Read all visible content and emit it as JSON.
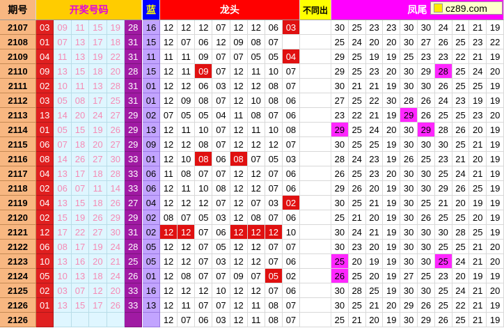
{
  "headers": {
    "period": "期号",
    "winning": "开奖号码",
    "blue": "蓝",
    "longtou": "龙头",
    "buchong": "不同出",
    "fengwei": "凤尾",
    "site": "cz89.com"
  },
  "rows": [
    {
      "period": "2107",
      "win": [
        "03",
        "09",
        "11",
        "15",
        "19",
        "28"
      ],
      "blue": "16",
      "lt": [
        "12",
        "12",
        "12",
        "07",
        "12",
        "12",
        "06",
        "03"
      ],
      "lt_hit": [
        7
      ],
      "fw": [
        "30",
        "25",
        "23",
        "23",
        "30",
        "30",
        "24",
        "21",
        "21",
        "19"
      ],
      "fw_hit": []
    },
    {
      "period": "2108",
      "win": [
        "01",
        "07",
        "13",
        "17",
        "18",
        "31"
      ],
      "blue": "15",
      "lt": [
        "12",
        "07",
        "06",
        "12",
        "09",
        "08",
        "07",
        ""
      ],
      "lt_hit": [],
      "fw": [
        "25",
        "24",
        "20",
        "20",
        "30",
        "27",
        "26",
        "25",
        "23",
        "22"
      ],
      "fw_hit": []
    },
    {
      "period": "2109",
      "win": [
        "04",
        "11",
        "13",
        "19",
        "22",
        "31"
      ],
      "blue": "11",
      "lt": [
        "11",
        "11",
        "09",
        "07",
        "07",
        "05",
        "05",
        "04"
      ],
      "lt_hit": [
        7
      ],
      "fw": [
        "29",
        "25",
        "19",
        "19",
        "25",
        "23",
        "23",
        "22",
        "21",
        "19"
      ],
      "fw_hit": []
    },
    {
      "period": "2110",
      "win": [
        "09",
        "13",
        "15",
        "18",
        "20",
        "28"
      ],
      "blue": "15",
      "lt": [
        "12",
        "11",
        "09",
        "07",
        "12",
        "11",
        "10",
        "07"
      ],
      "lt_hit": [
        2
      ],
      "fw": [
        "29",
        "25",
        "23",
        "20",
        "30",
        "29",
        "28",
        "25",
        "24",
        "20"
      ],
      "fw_hit": [
        6
      ]
    },
    {
      "period": "2111",
      "win": [
        "02",
        "10",
        "11",
        "13",
        "28",
        "31"
      ],
      "blue": "01",
      "lt": [
        "12",
        "12",
        "06",
        "03",
        "12",
        "12",
        "08",
        "07"
      ],
      "lt_hit": [],
      "fw": [
        "30",
        "21",
        "21",
        "19",
        "30",
        "30",
        "26",
        "25",
        "25",
        "19"
      ],
      "fw_hit": []
    },
    {
      "period": "2112",
      "win": [
        "03",
        "05",
        "08",
        "17",
        "25",
        "31"
      ],
      "blue": "01",
      "lt": [
        "12",
        "09",
        "08",
        "07",
        "12",
        "10",
        "08",
        "06"
      ],
      "lt_hit": [],
      "fw": [
        "27",
        "25",
        "22",
        "30",
        "28",
        "26",
        "24",
        "23",
        "19",
        "19"
      ],
      "fw_hit": []
    },
    {
      "period": "2113",
      "win": [
        "13",
        "14",
        "20",
        "24",
        "27",
        "29"
      ],
      "blue": "02",
      "lt": [
        "07",
        "05",
        "05",
        "04",
        "11",
        "08",
        "07",
        "06"
      ],
      "lt_hit": [],
      "fw": [
        "23",
        "22",
        "21",
        "19",
        "29",
        "26",
        "25",
        "25",
        "23",
        "20"
      ],
      "fw_hit": [
        4
      ]
    },
    {
      "period": "2114",
      "win": [
        "01",
        "05",
        "15",
        "19",
        "26",
        "29"
      ],
      "blue": "13",
      "lt": [
        "12",
        "11",
        "10",
        "07",
        "12",
        "11",
        "10",
        "08"
      ],
      "lt_hit": [],
      "fw": [
        "29",
        "25",
        "24",
        "20",
        "30",
        "29",
        "28",
        "26",
        "20",
        "19"
      ],
      "fw_hit": [
        0,
        5
      ]
    },
    {
      "period": "2115",
      "win": [
        "06",
        "07",
        "18",
        "20",
        "27",
        "29"
      ],
      "blue": "09",
      "lt": [
        "12",
        "12",
        "08",
        "07",
        "12",
        "12",
        "12",
        "07"
      ],
      "lt_hit": [],
      "fw": [
        "30",
        "25",
        "25",
        "19",
        "30",
        "30",
        "30",
        "25",
        "21",
        "19"
      ],
      "fw_hit": []
    },
    {
      "period": "2116",
      "win": [
        "08",
        "14",
        "26",
        "27",
        "30",
        "33"
      ],
      "blue": "01",
      "lt": [
        "12",
        "10",
        "08",
        "06",
        "08",
        "07",
        "05",
        "03"
      ],
      "lt_hit": [
        2,
        4
      ],
      "fw": [
        "28",
        "24",
        "23",
        "19",
        "26",
        "25",
        "23",
        "21",
        "20",
        "19"
      ],
      "fw_hit": []
    },
    {
      "period": "2117",
      "win": [
        "04",
        "13",
        "17",
        "18",
        "28",
        "33"
      ],
      "blue": "06",
      "lt": [
        "11",
        "08",
        "07",
        "07",
        "12",
        "12",
        "07",
        "06"
      ],
      "lt_hit": [],
      "fw": [
        "26",
        "25",
        "23",
        "20",
        "30",
        "30",
        "25",
        "24",
        "21",
        "19"
      ],
      "fw_hit": []
    },
    {
      "period": "2118",
      "win": [
        "02",
        "06",
        "07",
        "11",
        "14",
        "33"
      ],
      "blue": "06",
      "lt": [
        "12",
        "11",
        "10",
        "08",
        "12",
        "12",
        "07",
        "06"
      ],
      "lt_hit": [],
      "fw": [
        "29",
        "26",
        "20",
        "19",
        "30",
        "30",
        "29",
        "26",
        "25",
        "19"
      ],
      "fw_hit": []
    },
    {
      "period": "2119",
      "win": [
        "04",
        "13",
        "15",
        "18",
        "26",
        "27"
      ],
      "blue": "04",
      "lt": [
        "12",
        "12",
        "12",
        "07",
        "12",
        "07",
        "03",
        "02"
      ],
      "lt_hit": [
        7
      ],
      "fw": [
        "30",
        "25",
        "21",
        "19",
        "30",
        "25",
        "21",
        "20",
        "19",
        "19"
      ],
      "fw_hit": []
    },
    {
      "period": "2120",
      "win": [
        "02",
        "15",
        "19",
        "26",
        "29",
        "29"
      ],
      "blue": "02",
      "lt": [
        "08",
        "07",
        "05",
        "03",
        "12",
        "08",
        "07",
        "06"
      ],
      "lt_hit": [],
      "fw": [
        "25",
        "21",
        "20",
        "19",
        "30",
        "26",
        "25",
        "25",
        "20",
        "19"
      ],
      "fw_hit": []
    },
    {
      "period": "2121",
      "win": [
        "12",
        "17",
        "22",
        "27",
        "30",
        "31"
      ],
      "blue": "02",
      "lt": [
        "12",
        "12",
        "07",
        "06",
        "12",
        "12",
        "12",
        "10"
      ],
      "lt_hit": [
        0,
        1,
        4,
        5,
        6
      ],
      "fw": [
        "30",
        "24",
        "21",
        "19",
        "30",
        "30",
        "30",
        "28",
        "25",
        "19"
      ],
      "fw_hit": []
    },
    {
      "period": "2122",
      "win": [
        "06",
        "08",
        "17",
        "19",
        "24",
        "28"
      ],
      "blue": "05",
      "lt": [
        "12",
        "12",
        "07",
        "05",
        "12",
        "12",
        "07",
        "07"
      ],
      "lt_hit": [],
      "fw": [
        "30",
        "23",
        "20",
        "19",
        "30",
        "30",
        "25",
        "25",
        "21",
        "20"
      ],
      "fw_hit": []
    },
    {
      "period": "2123",
      "win": [
        "10",
        "13",
        "16",
        "20",
        "21",
        "25"
      ],
      "blue": "05",
      "lt": [
        "12",
        "12",
        "07",
        "03",
        "12",
        "12",
        "07",
        "06"
      ],
      "lt_hit": [],
      "fw": [
        "25",
        "20",
        "19",
        "19",
        "30",
        "30",
        "25",
        "24",
        "21",
        "20"
      ],
      "fw_hit": [
        0,
        6
      ]
    },
    {
      "period": "2124",
      "win": [
        "05",
        "10",
        "13",
        "18",
        "24",
        "26"
      ],
      "blue": "01",
      "lt": [
        "12",
        "08",
        "07",
        "07",
        "09",
        "07",
        "05",
        "02"
      ],
      "lt_hit": [
        6
      ],
      "fw": [
        "26",
        "25",
        "20",
        "19",
        "27",
        "25",
        "23",
        "20",
        "19",
        "19"
      ],
      "fw_hit": [
        0
      ]
    },
    {
      "period": "2125",
      "win": [
        "02",
        "03",
        "07",
        "12",
        "20",
        "33"
      ],
      "blue": "16",
      "lt": [
        "12",
        "12",
        "12",
        "10",
        "12",
        "12",
        "07",
        "06"
      ],
      "lt_hit": [],
      "fw": [
        "30",
        "28",
        "25",
        "19",
        "30",
        "30",
        "25",
        "24",
        "21",
        "20"
      ],
      "fw_hit": []
    },
    {
      "period": "2126",
      "win": [
        "01",
        "13",
        "15",
        "17",
        "26",
        "33"
      ],
      "blue": "13",
      "lt": [
        "12",
        "11",
        "07",
        "07",
        "12",
        "11",
        "08",
        "07"
      ],
      "lt_hit": [],
      "fw": [
        "30",
        "25",
        "21",
        "20",
        "29",
        "26",
        "25",
        "22",
        "21",
        "19"
      ],
      "fw_hit": []
    },
    {
      "period": "2126",
      "win": [
        "",
        "",
        "",
        "",
        "",
        ""
      ],
      "blue": "",
      "lt": [
        "12",
        "07",
        "06",
        "03",
        "12",
        "11",
        "08",
        "07"
      ],
      "lt_hit": [],
      "fw": [
        "25",
        "21",
        "20",
        "19",
        "30",
        "29",
        "26",
        "25",
        "21",
        "19"
      ],
      "fw_hit": []
    }
  ],
  "colors": {
    "period_bg": "#f8b781",
    "first_ball": "#e02020",
    "last_ball": "#a01aa3",
    "blue_col": "#c2a4ff",
    "longtou_hit": "#e01010",
    "fengwei_hit": "#ff26ff"
  }
}
